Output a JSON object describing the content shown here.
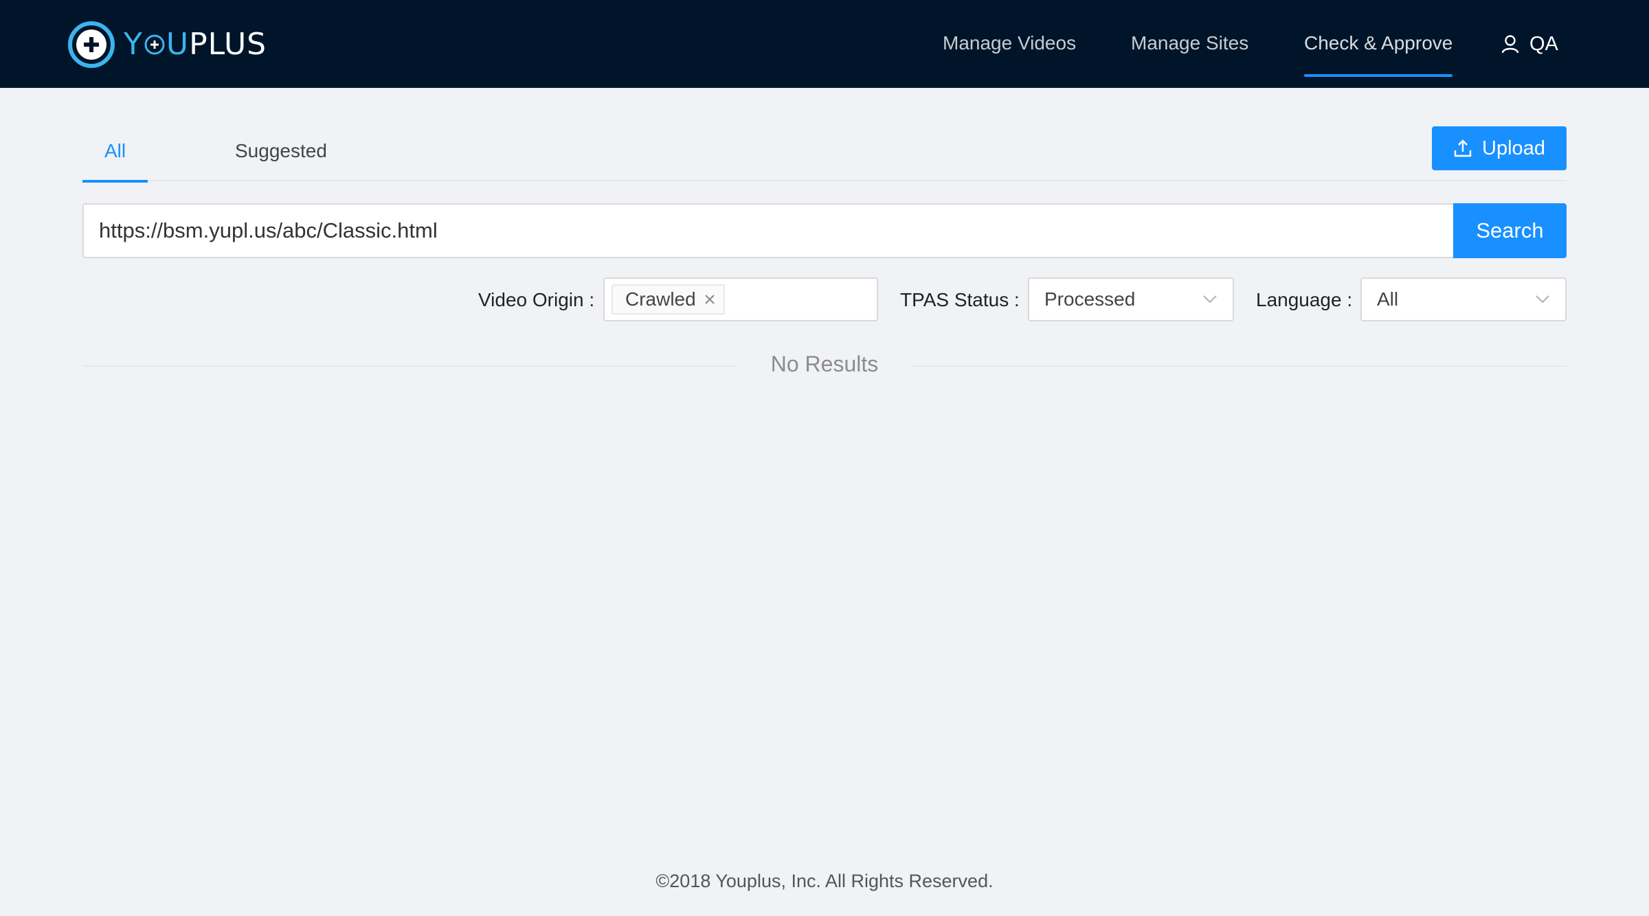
{
  "brand": {
    "name_you": "YOU",
    "name_you_first": "Y",
    "name_you_last": "U",
    "name_plus": "PLUS",
    "accent_color": "#3cb4ef",
    "header_bg": "#001529",
    "primary_color": "#1890ff"
  },
  "nav": {
    "items": [
      {
        "label": "Manage Videos",
        "active": false
      },
      {
        "label": "Manage Sites",
        "active": false
      },
      {
        "label": "Check & Approve",
        "active": true
      }
    ],
    "user": {
      "icon": "user-icon",
      "name": "QA"
    }
  },
  "tabs": [
    {
      "label": "All",
      "active": true
    },
    {
      "label": "Suggested",
      "active": false
    }
  ],
  "toolbar": {
    "upload_label": "Upload",
    "upload_icon": "upload-icon"
  },
  "search": {
    "value": "https://bsm.yupl.us/abc/Classic.html",
    "button_label": "Search"
  },
  "filters": {
    "video_origin": {
      "label": "Video Origin",
      "tags": [
        "Crawled"
      ]
    },
    "tpas_status": {
      "label": "TPAS Status",
      "value": "Processed"
    },
    "language": {
      "label": "Language",
      "value": "All"
    }
  },
  "results": {
    "empty_text": "No Results"
  },
  "footer": {
    "text": "©2018 Youplus, Inc. All Rights Reserved."
  }
}
